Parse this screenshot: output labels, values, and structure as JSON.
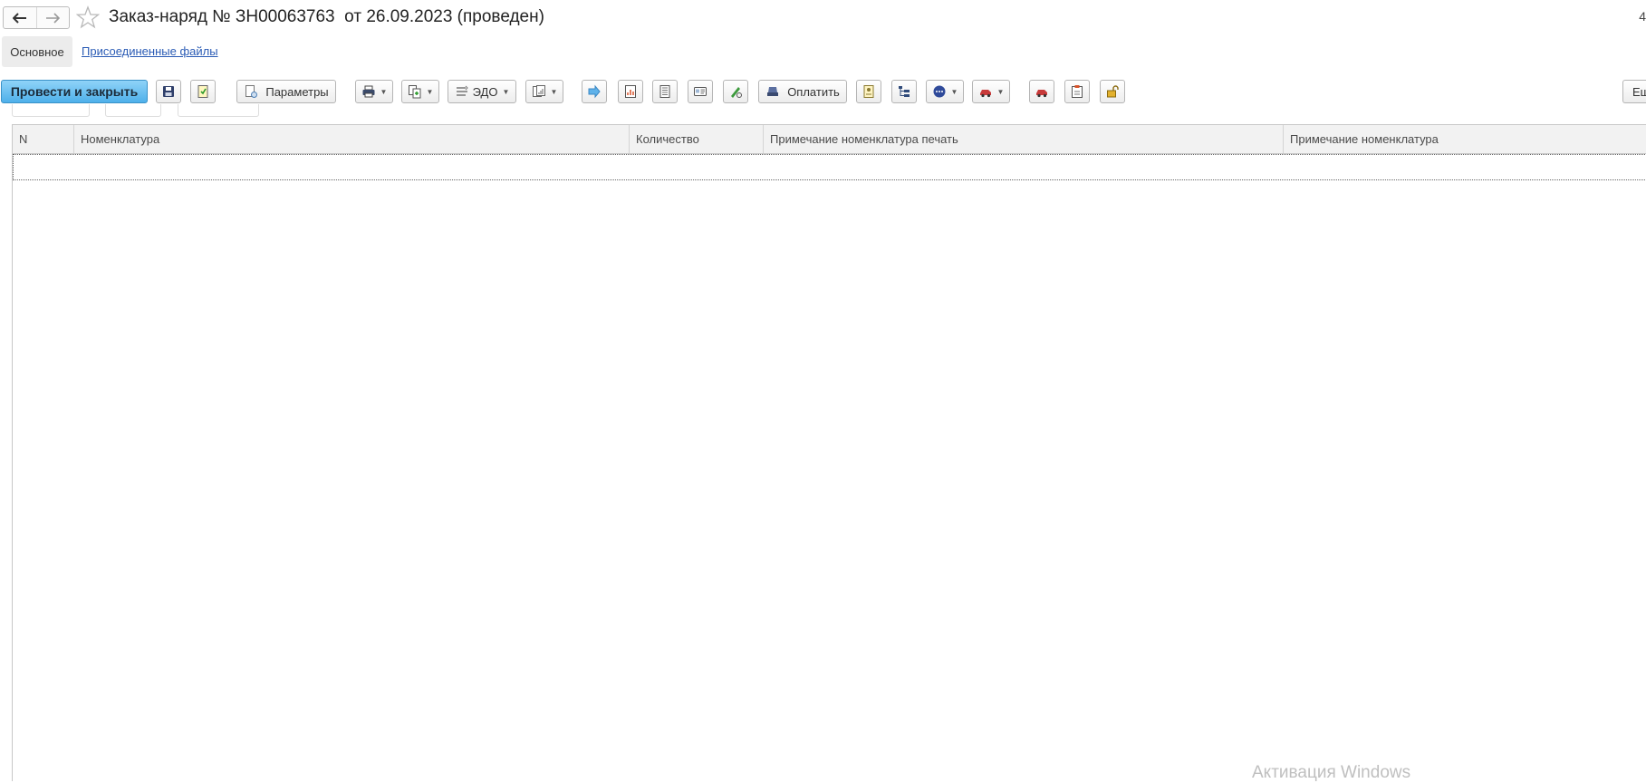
{
  "window": {
    "title": "Заказ-наряд № ЗН00063763  от 26.09.2023 (проведен)",
    "corner_char": "4"
  },
  "nav": {
    "back_icon": "arrow-left-icon",
    "forward_icon": "arrow-right-icon",
    "favorite_icon": "star-outline-icon"
  },
  "tabs": {
    "main": "Основное",
    "files": "Присоединенные файлы"
  },
  "toolbar": {
    "post_close": "Провести и закрыть",
    "params": "Параметры",
    "edo": "ЭДО",
    "pay": "Оплатить",
    "more_cut": "Ещ"
  },
  "table": {
    "columns": [
      "N",
      "Номенклатура",
      "Количество",
      "Примечание номенклатура печать",
      "Примечание номенклатура"
    ],
    "rows": []
  },
  "watermark": "Активация Windows",
  "colors": {
    "primary_button": "#4eb0ea",
    "link": "#2a5bb5",
    "header_bg": "#f2f2f2"
  }
}
